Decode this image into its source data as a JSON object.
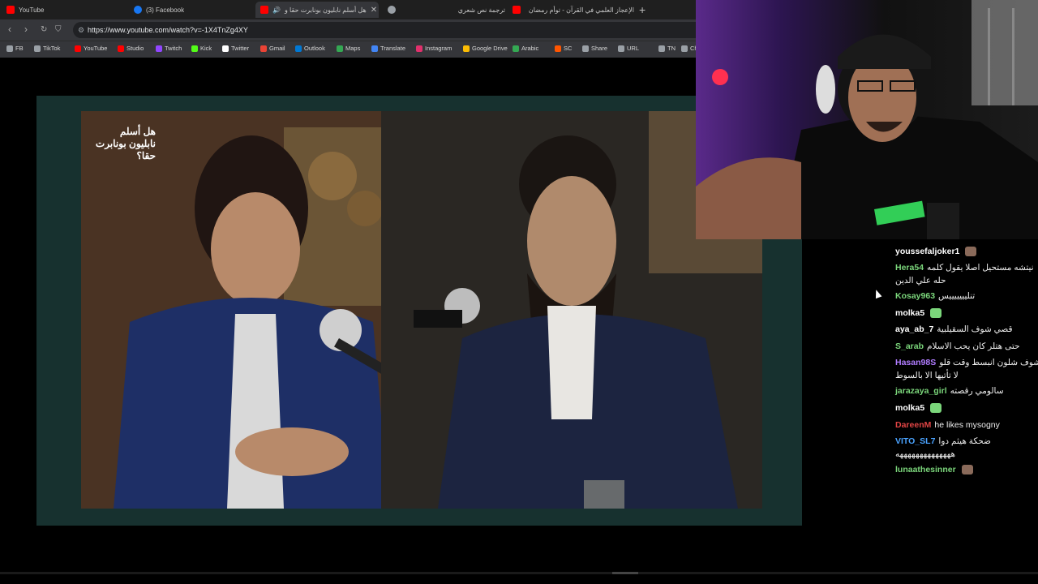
{
  "browser": {
    "tabs": [
      {
        "title": "YouTube",
        "icon": "youtube-icon",
        "active": false
      },
      {
        "title": "(3) Facebook",
        "icon": "facebook-icon",
        "active": false
      },
      {
        "title": "هل أسلم نابليون بونابرت حقا و",
        "icon": "youtube-icon",
        "active": true
      },
      {
        "title": "ترجمة نص شعري",
        "icon": "site-icon",
        "active": false
      },
      {
        "title": "الإعجاز العلمي في القرآن - توأم رمضان",
        "icon": "youtube-icon",
        "active": false
      }
    ],
    "url": "https://www.youtube.com/watch?v=-1X4TnZg4XY",
    "bookmarks": [
      {
        "label": "FB",
        "color": "#9aa0a6"
      },
      {
        "label": "TikTok",
        "color": "#9aa0a6"
      },
      {
        "label": "YouTube",
        "color": "#ff0000"
      },
      {
        "label": "Studio",
        "color": "#ff0000"
      },
      {
        "label": "Twitch",
        "color": "#9146ff"
      },
      {
        "label": "Kick",
        "color": "#53fc18"
      },
      {
        "label": "Twitter",
        "color": "#ffffff"
      },
      {
        "label": "Gmail",
        "color": "#ea4335"
      },
      {
        "label": "Outlook",
        "color": "#0078d4"
      },
      {
        "label": "Maps",
        "color": "#34a853"
      },
      {
        "label": "Translate",
        "color": "#4285f4"
      },
      {
        "label": "Instagram",
        "color": "#e1306c"
      },
      {
        "label": "Google Drive",
        "color": "#fbbc04"
      },
      {
        "label": "Arabic",
        "color": "#34a853"
      },
      {
        "label": "SC",
        "color": "#ff5500"
      },
      {
        "label": "Share",
        "color": "#9aa0a6"
      },
      {
        "label": "URL",
        "color": "#9aa0a6"
      },
      {
        "label": "TN",
        "color": "#9aa0a6"
      },
      {
        "label": "Cha",
        "color": "#9aa0a6"
      }
    ]
  },
  "video": {
    "overlay_title": "هل أسلم نابليون بونابرت حقا؟"
  },
  "chat": {
    "messages": [
      {
        "user": "youssefaljoker1",
        "color": "#ffffff",
        "text": ""
      },
      {
        "user": "Hera54",
        "color": "#7bd67b",
        "text": "نيتشه مستحيل اصلا يقول كلمه"
      },
      {
        "user": "",
        "color": "#ffffff",
        "text": "حله علي الدين"
      },
      {
        "user": "Kosay963",
        "color": "#7bd67b",
        "text": "تنليييييييس"
      },
      {
        "user": "molka5",
        "color": "#ffffff",
        "text": ""
      },
      {
        "user": "aya_ab_7",
        "color": "#ffffff",
        "text": "قصي شوف السقيلبية"
      },
      {
        "user": "S_arab",
        "color": "#7bd67b",
        "text": "حتى هتلر كان يحب الاسلام"
      },
      {
        "user": "Hasan98S",
        "color": "#b07cff",
        "text": "شوف شلون انبسط وقت قلو"
      },
      {
        "user": "",
        "color": "#ffffff",
        "text": "لا تأتيها الا بالسوط"
      },
      {
        "user": "jarazaya_girl",
        "color": "#7bd67b",
        "text": "سالومي رقصته"
      },
      {
        "user": "molka5",
        "color": "#ffffff",
        "text": ""
      },
      {
        "user": "DareenM",
        "color": "#e04444",
        "text": "he likes mysogny"
      },
      {
        "user": "VITO_SL7",
        "color": "#4aa3ff",
        "text": "ضحكة هيثم دوا"
      },
      {
        "user": "",
        "color": "#ffffff",
        "text": "ههههههههههههههه"
      },
      {
        "user": "lunaathesinner",
        "color": "#7bd67b",
        "text": ""
      }
    ]
  },
  "colors": {
    "accent_green": "#7bd67b",
    "browser_bg": "#35363a"
  }
}
